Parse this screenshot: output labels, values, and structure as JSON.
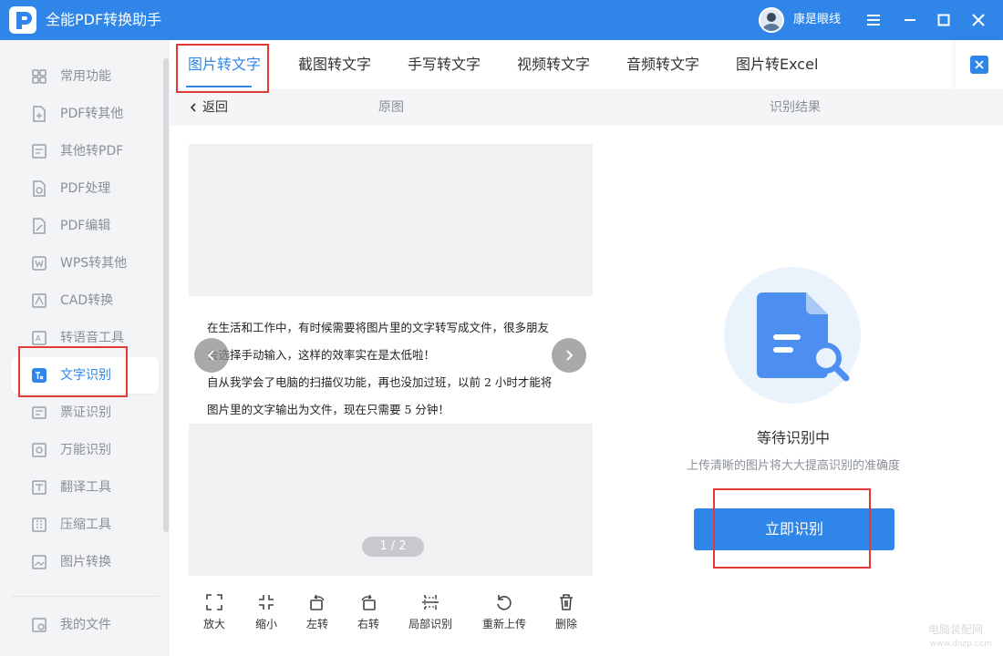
{
  "app": {
    "title": "全能PDF转换助手",
    "username": "康是眼线",
    "accent_color": "#2f86e8"
  },
  "window_controls": {
    "menu_icon": "hamburger-icon",
    "minimize_icon": "minimize-icon",
    "maximize_icon": "maximize-icon",
    "close_icon": "close-icon"
  },
  "sidebar": {
    "items": [
      {
        "label": "常用功能",
        "icon": "grid-icon"
      },
      {
        "label": "PDF转其他",
        "icon": "pdf-export-icon"
      },
      {
        "label": "其他转PDF",
        "icon": "pdf-import-icon"
      },
      {
        "label": "PDF处理",
        "icon": "pdf-process-icon"
      },
      {
        "label": "PDF编辑",
        "icon": "pdf-edit-icon"
      },
      {
        "label": "WPS转其他",
        "icon": "wps-icon"
      },
      {
        "label": "CAD转换",
        "icon": "cad-icon"
      },
      {
        "label": "转语音工具",
        "icon": "speech-icon"
      },
      {
        "label": "文字识别",
        "icon": "ocr-icon",
        "active": true
      },
      {
        "label": "票证识别",
        "icon": "ticket-icon"
      },
      {
        "label": "万能识别",
        "icon": "universal-recognition-icon"
      },
      {
        "label": "翻译工具",
        "icon": "translate-icon"
      },
      {
        "label": "压缩工具",
        "icon": "compress-icon"
      },
      {
        "label": "图片转换",
        "icon": "image-convert-icon"
      }
    ],
    "footer_item": {
      "label": "我的文件",
      "icon": "my-files-icon"
    }
  },
  "tabs": [
    {
      "label": "图片转文字",
      "active": true
    },
    {
      "label": "截图转文字"
    },
    {
      "label": "手写转文字"
    },
    {
      "label": "视频转文字"
    },
    {
      "label": "音频转文字"
    },
    {
      "label": "图片转Excel"
    }
  ],
  "subheader": {
    "back_label": "返回",
    "original_label": "原图",
    "result_label": "识别结果"
  },
  "preview": {
    "text_lines": [
      "在生活和工作中，有时候需要将图片里的文字转写成文件，很多朋友",
      "会选择手动输入，这样的效率实在是太低啦！",
      "自从我学会了电脑的扫描仪功能，再也没加过班，以前 2 小时才能将",
      "图片里的文字输出为文件，现在只需要 5 分钟！"
    ],
    "page_indicator": "1 / 2"
  },
  "toolbar": {
    "zoom_in": "放大",
    "zoom_out": "缩小",
    "rotate_left": "左转",
    "rotate_right": "右转",
    "partial_ocr": "局部识别",
    "reupload": "重新上传",
    "delete": "删除"
  },
  "result": {
    "status_title": "等待识别中",
    "hint": "上传清晰的图片将大大提高识别的准确度",
    "recognize_button": "立即识别"
  },
  "watermark": {
    "line1": "电脑装配网",
    "line2": "www.dnzp.com"
  }
}
